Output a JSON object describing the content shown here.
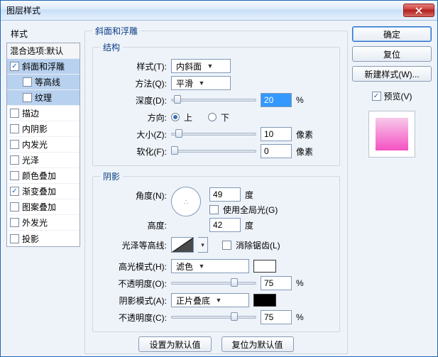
{
  "window": {
    "title": "图层样式"
  },
  "left": {
    "header": "样式",
    "blend_defaults": "混合选项:默认",
    "items": [
      {
        "label": "斜面和浮雕",
        "checked": true,
        "selected": true,
        "indent": false
      },
      {
        "label": "等高线",
        "checked": false,
        "selected": true,
        "indent": true
      },
      {
        "label": "纹理",
        "checked": false,
        "selected": true,
        "indent": true
      },
      {
        "label": "描边",
        "checked": false,
        "selected": false,
        "indent": false
      },
      {
        "label": "内阴影",
        "checked": false,
        "selected": false,
        "indent": false
      },
      {
        "label": "内发光",
        "checked": false,
        "selected": false,
        "indent": false
      },
      {
        "label": "光泽",
        "checked": false,
        "selected": false,
        "indent": false
      },
      {
        "label": "颜色叠加",
        "checked": false,
        "selected": false,
        "indent": false
      },
      {
        "label": "渐变叠加",
        "checked": true,
        "selected": false,
        "indent": false
      },
      {
        "label": "图案叠加",
        "checked": false,
        "selected": false,
        "indent": false
      },
      {
        "label": "外发光",
        "checked": false,
        "selected": false,
        "indent": false
      },
      {
        "label": "投影",
        "checked": false,
        "selected": false,
        "indent": false
      }
    ]
  },
  "panel": {
    "title": "斜面和浮雕",
    "structure": {
      "legend": "结构",
      "style_label": "样式(T):",
      "style_value": "内斜面",
      "technique_label": "方法(Q):",
      "technique_value": "平滑",
      "depth_label": "深度(D):",
      "depth_value": "20",
      "depth_unit": "%",
      "direction_label": "方向:",
      "direction_up": "上",
      "direction_down": "下",
      "size_label": "大小(Z):",
      "size_value": "10",
      "size_unit": "像素",
      "soften_label": "软化(F):",
      "soften_value": "0",
      "soften_unit": "像素"
    },
    "shading": {
      "legend": "阴影",
      "angle_label": "角度(N):",
      "angle_value": "49",
      "angle_unit": "度",
      "global_light_label": "使用全局光(G)",
      "altitude_label": "高度:",
      "altitude_value": "42",
      "altitude_unit": "度",
      "gloss_label": "光泽等高线:",
      "antialias_label": "消除锯齿(L)",
      "highlight_mode_label": "高光模式(H):",
      "highlight_mode_value": "滤色",
      "highlight_opacity_label": "不透明度(O):",
      "highlight_opacity_value": "75",
      "highlight_opacity_unit": "%",
      "shadow_mode_label": "阴影模式(A):",
      "shadow_mode_value": "正片叠底",
      "shadow_opacity_label": "不透明度(C):",
      "shadow_opacity_value": "75",
      "shadow_opacity_unit": "%"
    },
    "buttons": {
      "make_default": "设置为默认值",
      "reset_default": "复位为默认值"
    }
  },
  "right": {
    "ok": "确定",
    "reset": "复位",
    "new_style": "新建样式(W)...",
    "preview_label": "预览(V)"
  }
}
